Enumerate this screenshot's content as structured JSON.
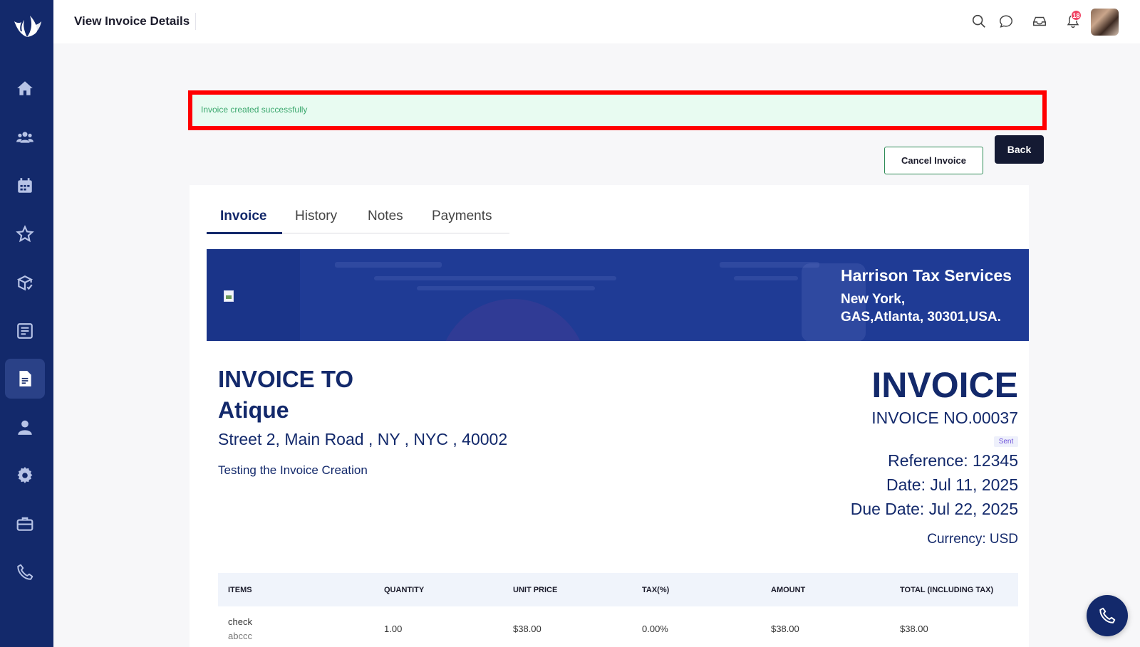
{
  "header": {
    "title": "View Invoice Details",
    "notification_count": "18"
  },
  "sidebar": {
    "items": [
      {
        "icon": "home-icon"
      },
      {
        "icon": "users-icon"
      },
      {
        "icon": "calendar-icon"
      },
      {
        "icon": "star-icon"
      },
      {
        "icon": "box-icon"
      },
      {
        "icon": "billing-icon"
      },
      {
        "icon": "invoice-icon",
        "active": true
      },
      {
        "icon": "user-icon"
      },
      {
        "icon": "settings-icon"
      },
      {
        "icon": "briefcase-icon"
      },
      {
        "icon": "phone-icon"
      }
    ]
  },
  "alert": {
    "message": "Invoice created successfully"
  },
  "actions": {
    "cancel_label": "Cancel Invoice",
    "back_label": "Back"
  },
  "tabs": [
    {
      "label": "Invoice",
      "active": true
    },
    {
      "label": "History"
    },
    {
      "label": "Notes"
    },
    {
      "label": "Payments"
    }
  ],
  "company": {
    "name": "Harrison Tax Services",
    "address_line1": "New York,",
    "address_line2": "GAS,Atlanta, 30301,USA."
  },
  "bill_to": {
    "heading": "INVOICE TO",
    "name": "Atique",
    "address": "Street 2, Main Road , NY , NYC , 40002",
    "note": "Testing the Invoice Creation"
  },
  "invoice": {
    "heading": "INVOICE",
    "number": "INVOICE NO.00037",
    "status": "Sent",
    "reference": "Reference: 12345",
    "date": "Date: Jul 11, 2025",
    "due_date": "Due Date: Jul 22, 2025",
    "currency": "Currency: USD"
  },
  "table": {
    "columns": [
      "ITEMS",
      "QUANTITY",
      "UNIT PRICE",
      "TAX(%)",
      "AMOUNT",
      "TOTAL (INCLUDING TAX)"
    ],
    "rows": [
      {
        "item": "check",
        "description": "abccc",
        "quantity": "1.00",
        "unit_price": "$38.00",
        "tax": "0.00%",
        "amount": "$38.00",
        "total": "$38.00"
      }
    ]
  },
  "colors": {
    "sidebar": "#13296b",
    "banner": "#1f3b95",
    "alert_bg": "#e8fbf1",
    "alert_border": "#ff0000",
    "primary_text": "#13296b"
  }
}
